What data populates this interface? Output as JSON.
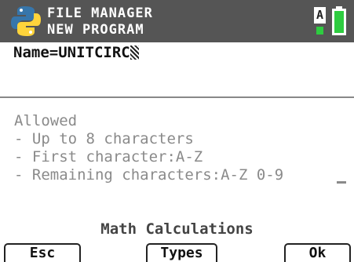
{
  "status_bar": {
    "title": "FILE MANAGER",
    "subtitle": "NEW PROGRAM",
    "alpha_indicator": "A",
    "logo_icon": "python-logo-icon",
    "battery_icon": "battery-icon",
    "colors": {
      "background": "#555555",
      "python_blue": "#3776ab",
      "python_yellow": "#ffd43b",
      "indicator_green": "#2ecc40"
    }
  },
  "name_field": {
    "label": "Name=",
    "value": "UNITCIRC"
  },
  "hints": {
    "heading": "Allowed",
    "lines": [
      "- Up to 8 characters",
      "- First character:A-Z",
      "- Remaining characters:A-Z 0-9"
    ]
  },
  "footer": {
    "title": "Math Calculations"
  },
  "softkeys": {
    "esc": "Esc",
    "types": "Types",
    "ok": "Ok"
  }
}
